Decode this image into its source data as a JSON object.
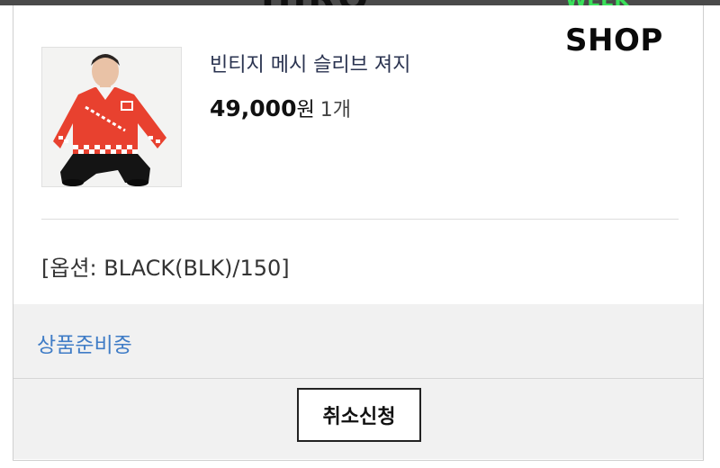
{
  "header": {
    "brand_text": "HIRO",
    "brand_accent": "WEEK",
    "shop_label": "SHOP"
  },
  "order_item": {
    "product_name": "빈티지 메시 슬리브 져지",
    "price": "49,000",
    "price_unit": "원",
    "quantity": "1개",
    "option": "[옵션: BLACK(BLK)/150]",
    "image_alt": "product-photo-red-jersey"
  },
  "status": {
    "label": "상품준비중"
  },
  "actions": {
    "cancel_label": "취소신청"
  },
  "colors": {
    "status_blue": "#3f7cc6",
    "jersey_red": "#e8412f",
    "band_gray": "#f1f1f1",
    "brand_green": "#39e05a"
  }
}
